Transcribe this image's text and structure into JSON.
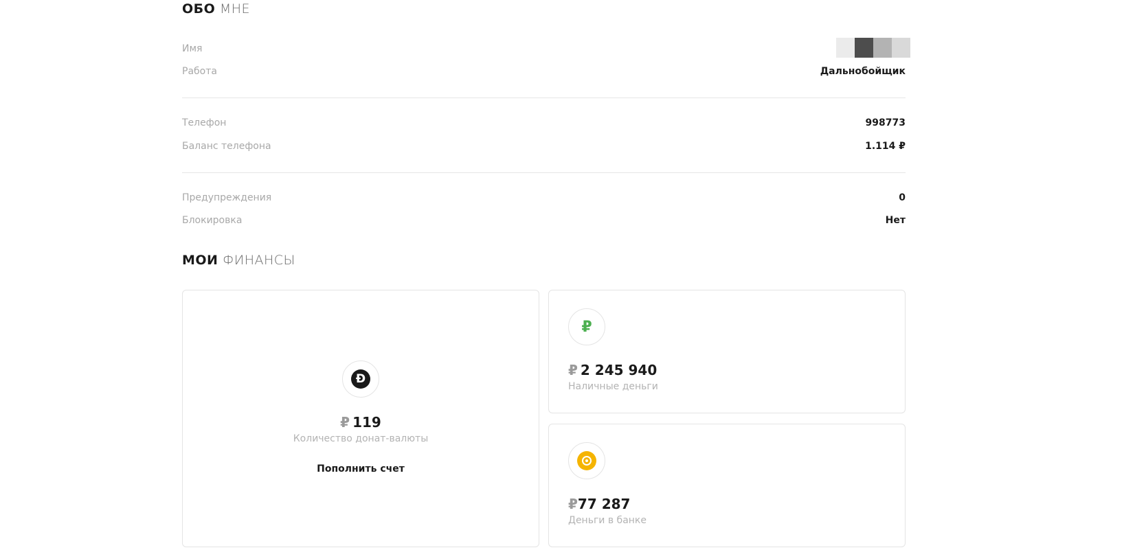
{
  "about": {
    "title_bold": "ОБО",
    "title_light": "МНЕ",
    "rows": [
      {
        "label": "Имя",
        "value": ""
      },
      {
        "label": "Работа",
        "value": "Дальнобойщик"
      },
      {
        "label": "Телефон",
        "value": "998773"
      },
      {
        "label": "Баланс телефона",
        "value": "1.114 ₽"
      },
      {
        "label": "Предупреждения",
        "value": "0"
      },
      {
        "label": "Блокировка",
        "value": "Нет"
      }
    ],
    "name_mask_colors": [
      "#ebebeb",
      "#4d4d4d",
      "#b3b3b3",
      "#d9d9d9"
    ]
  },
  "finances": {
    "title_bold": "МОИ",
    "title_light": "ФИНАНСЫ",
    "currency_symbol": "₽",
    "donate": {
      "icon": "donate-coin-icon",
      "icon_glyph": "Ð",
      "amount": "119",
      "caption": "Количество донат-валюты",
      "button": "Пополнить счет"
    },
    "cash": {
      "icon": "ruble-icon",
      "icon_glyph": "₽",
      "amount": "2 245 940",
      "caption": "Наличные деньги"
    },
    "bank": {
      "icon": "bank-coin-icon",
      "amount": "77 287",
      "caption": "Деньги в банке"
    }
  },
  "colors": {
    "cash_icon": "#4caf50",
    "bank_icon": "#f5b400",
    "donate_icon": "#1a1a1a"
  }
}
